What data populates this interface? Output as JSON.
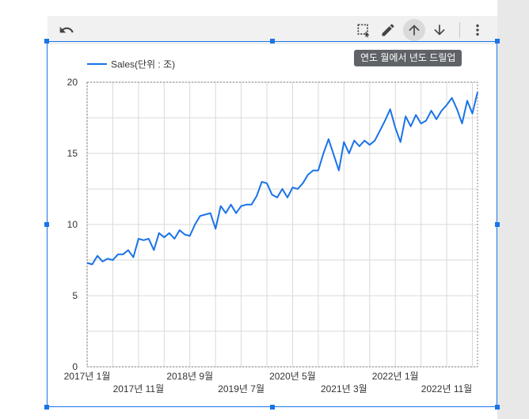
{
  "toolbar": {
    "undo_icon": "undo-icon",
    "select_icon": "select-region-icon",
    "edit_icon": "pencil-icon",
    "drill_up_icon": "arrow-up-icon",
    "drill_down_icon": "arrow-down-icon",
    "more_icon": "more-vert-icon"
  },
  "tooltip": {
    "text": "연도 월에서 년도 드릴업"
  },
  "colors": {
    "accent": "#1a73e8",
    "line": "#1a73e8",
    "grid": "#d9d9d9"
  },
  "chart_data": {
    "type": "line",
    "legend_position": "top-left",
    "grid": true,
    "ylim": [
      0,
      20
    ],
    "yticks": [
      0,
      5,
      10,
      15,
      20
    ],
    "x_tick_labels_row1": [
      "2017년 1월",
      "2018년 9월",
      "2020년 5월",
      "2022년 1월"
    ],
    "x_tick_labels_row2": [
      "2017년 11월",
      "2019년 7월",
      "2021년 3월",
      "2022년 11월"
    ],
    "x_start": "2017-01",
    "x_end": "2023-05",
    "series": [
      {
        "name": "Sales(단위 : 조)",
        "values": [
          7.3,
          7.2,
          7.8,
          7.4,
          7.6,
          7.5,
          7.9,
          7.9,
          8.2,
          7.7,
          9.0,
          8.9,
          9.0,
          8.2,
          9.4,
          9.1,
          9.4,
          9.0,
          9.6,
          9.3,
          9.2,
          10.0,
          10.6,
          10.7,
          10.8,
          9.7,
          11.3,
          10.8,
          11.4,
          10.8,
          11.3,
          11.4,
          11.4,
          12.0,
          13.0,
          12.9,
          12.1,
          11.9,
          12.5,
          11.9,
          12.6,
          12.5,
          12.9,
          13.5,
          13.8,
          13.8,
          15.0,
          16.0,
          14.9,
          13.8,
          15.8,
          15.0,
          15.9,
          15.5,
          15.9,
          15.6,
          15.9,
          16.6,
          17.3,
          18.1,
          16.8,
          15.8,
          17.6,
          16.9,
          17.7,
          17.1,
          17.3,
          18.0,
          17.4,
          18.0,
          18.4,
          18.9,
          18.1,
          17.1,
          18.7,
          17.8,
          19.3
        ]
      }
    ]
  }
}
